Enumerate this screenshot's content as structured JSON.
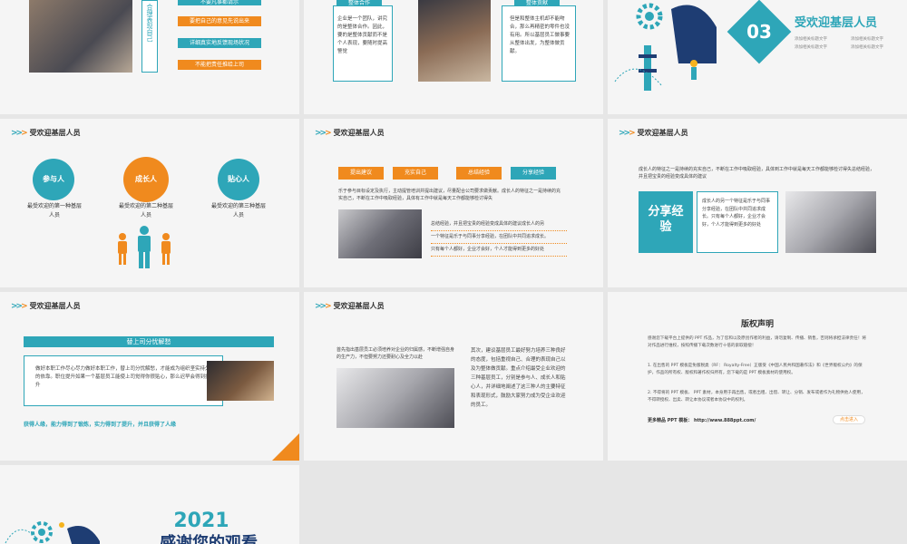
{
  "slide1": {
    "vertical_text": "合理表现自己",
    "items": [
      "不要凡事都请示",
      "要把自己的意见先说出来",
      "详细真实地反馈现场状况",
      "不能把责任推给上司"
    ]
  },
  "slide2": {
    "left_title": "整体合作",
    "left_text": "企业是一个团队，讲究的是整体合作。因此，要的是整体贡献而不是个人表现，要随时提高警觉",
    "right_title": "整体贡献",
    "right_text": "但是和整体主机却不能吻合，那么再精密的零件也没有用。所以基层员工做事要从整体出发，为整体做贡献。"
  },
  "slide3": {
    "number": "03",
    "title": "受欢迎基层人员",
    "bullets": [
      "添加相关标题文字",
      "添加相关标题文字",
      "添加相关标题文字",
      "添加相关标题文字"
    ]
  },
  "slide4": {
    "header": "受欢迎基层人员",
    "circles": [
      {
        "label": "参与人",
        "caption": "最受欢迎的第一种基层人员"
      },
      {
        "label": "成长人",
        "caption": "最受欢迎的第二种基层人员"
      },
      {
        "label": "贴心人",
        "caption": "最受欢迎的第三种基层人员"
      }
    ]
  },
  "slide5": {
    "header": "受欢迎基层人员",
    "tags": [
      "提出建议",
      "充实自己",
      "总结经验",
      "分享经验"
    ],
    "para": "乐于参与目标设定及执行，主动提管培训并提出建议，尽量配合公司要求做贡献。成长人的特征之一是持续的充实自己，不断在工作中吸取经验，具体有工作中就是每天工作都能够检讨得失",
    "right_lines": [
      "总结经验，并且把宝贵的经验变成具体的建议成长人的另",
      "一个特征是乐于与同事分享经验，在团队中共同追求成长。",
      "只有每个人都好，企业才会好，个人才能得到更多的好处"
    ]
  },
  "slide6": {
    "header": "受欢迎基层人员",
    "intro": "成长人的特征之一是持续的充实自己，不断在工作中吸取经验，具体到工作中就是每天工作都能够检讨得失总结经验，并且把宝贵的经验变成具体的建议",
    "label": "分享经验",
    "box_text": "成长人的另一个特征是乐于与同事分享经验，在团队中共同追求成长。只有每个人都好，企业才会好，个人才能得到更多的好处"
  },
  "slide7": {
    "header": "受欢迎基层人员",
    "banner": "替上司分忧解愁",
    "body": "做好本职工作尽心尽力做好本职工作，替上司分忧解愁，才能成为组织坚实持久的依靠。职位提升如果一个基层员工能使上司觉得你很贴心，那么迟早会得到提升",
    "footer": "获得人缘，能力得到了锻炼，实力得到了提升，并且获得了人缘"
  },
  "slide8": {
    "header": "受欢迎基层人员",
    "top_text": "首先指出基层员工必须培养对企业的归属感，不断增强自身的生产力，不但要努力还要耐心及全力以赴",
    "right_text": "其次，建议基层员工最好努力培养三种良好的态度，包括重视自己、合理的表现自己以及为整体做贡献。重点介绍最受企业欢迎的三种基层员工，分别是参与人、成长人和贴心人，并详细地阐述了这三种人的主要特征和表现形式，鼓励大家努力成为受企业欢迎的员工。"
  },
  "slide9": {
    "title": "版权声明",
    "para1": "感谢您下载平台上提供的 PPT 作品，为了您和以及原创作者的利益，请勿复制、传播、销售，否则将承担法律责任！将对作品进行维权，按照传播下载次数进行十倍的索取赔偿！",
    "para2": "1. 在出售的 PPT 模板是免版税类（RF： Royalty-Free）正版受《中国人民共和国著作法》和《世界版权公约》的保护，作品的所有权、版权和著作权归所有，您下载的是 PPT 模板素材的使用权。",
    "para3": "2. 不得将的 PPT 模板、 PPT 素材，本身用于再出售，或者出租、出借、转让、分销、发布或者作为礼物供他人使用，不得转授权、出卖、转让本协议或者本协议中的权利。",
    "more_label": "更多精品 PPT 模板： http://www.888ppt.com/",
    "button": "点击进入"
  },
  "slide10": {
    "year": "2021",
    "title": "感谢您的观看"
  },
  "colors": {
    "teal": "#2ea6b8",
    "orange": "#f08a1e",
    "navy": "#1e3d73"
  }
}
